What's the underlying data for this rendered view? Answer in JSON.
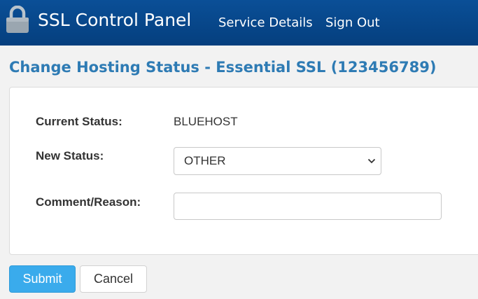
{
  "header": {
    "app_title": "SSL Control Panel",
    "nav": [
      {
        "label": "Service Details"
      },
      {
        "label": "Sign Out"
      }
    ],
    "logo_icon": "lock-icon"
  },
  "page": {
    "title": "Change Hosting Status - Essential SSL (123456789)"
  },
  "form": {
    "current_status_label": "Current Status:",
    "current_status_value": "BLUEHOST",
    "new_status_label": "New Status:",
    "new_status_selected": "OTHER",
    "comment_label": "Comment/Reason:",
    "comment_value": "",
    "comment_placeholder": ""
  },
  "buttons": {
    "submit_label": "Submit",
    "cancel_label": "Cancel"
  },
  "colors": {
    "header_bg": "#0a4f97",
    "title_color": "#2e7bb4",
    "submit_bg": "#3aabec"
  }
}
